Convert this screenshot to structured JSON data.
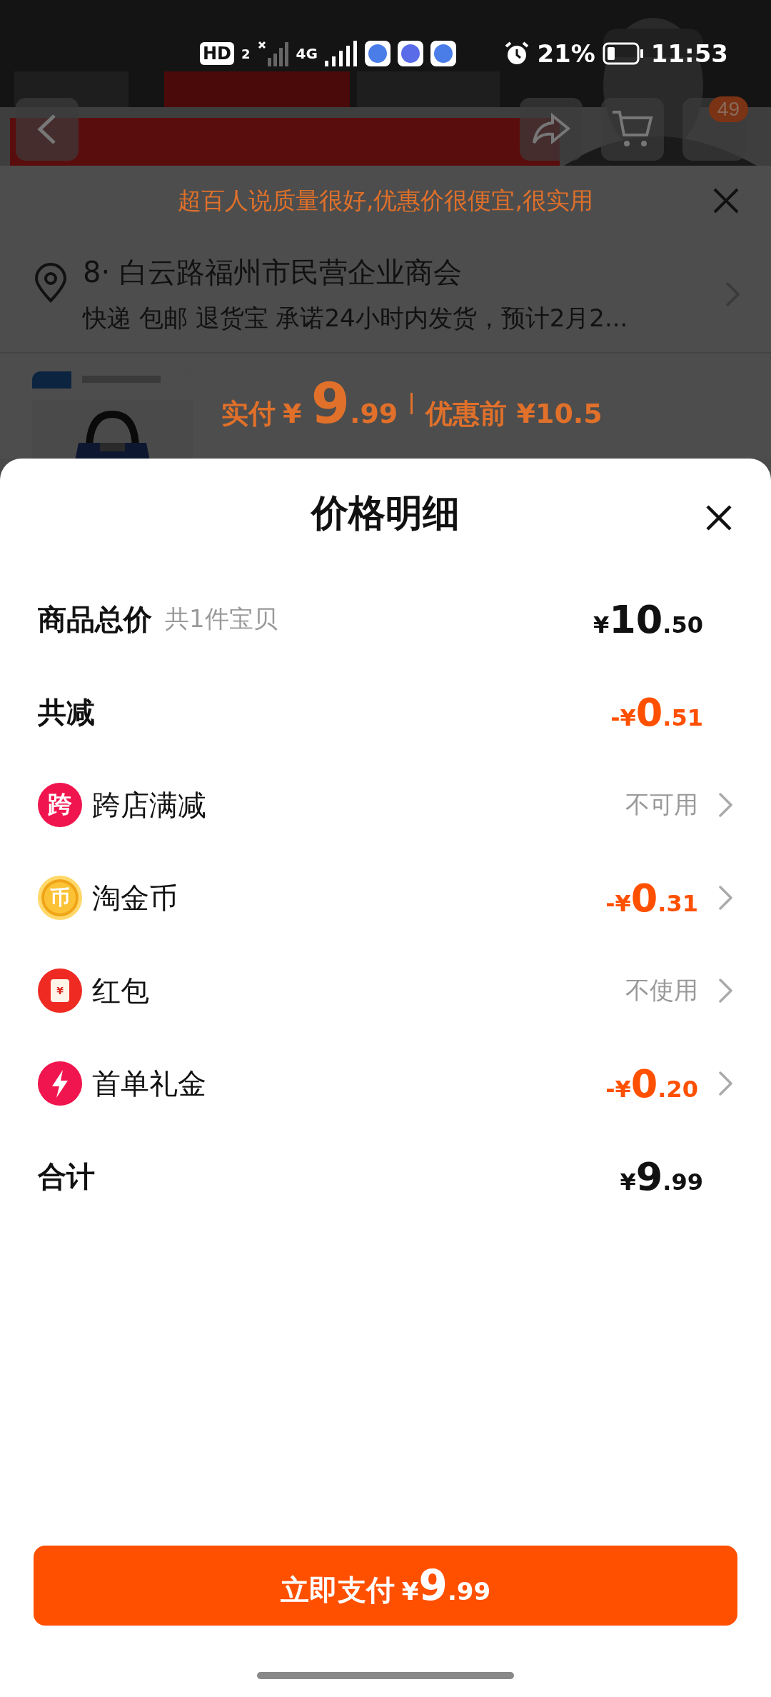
{
  "status_bar": {
    "hd": "HD",
    "sim": "2",
    "network": "4G",
    "battery_percent": "21%",
    "time": "11:53"
  },
  "header": {
    "cart_badge": "49"
  },
  "notice": {
    "text": "超百人说质量很好,优惠价很便宜,很实用"
  },
  "address": {
    "line": "8· 白云路福州市民营企业商会",
    "details": "快递 包邮 退货宝 承诺24小时内发货，预计2月2..."
  },
  "product": {
    "paid_label": "实付",
    "price": {
      "currency": "¥",
      "integer": "9",
      "decimal": ".99"
    },
    "before_label": "优惠前 ¥10.5"
  },
  "sheet": {
    "title": "价格明细",
    "rows": [
      {
        "kind": "summary",
        "label": "商品总价",
        "note": "共1件宝贝",
        "price": {
          "currency": "¥",
          "integer": "10",
          "decimal": ".50",
          "discount": false
        }
      },
      {
        "kind": "summary",
        "label": "共减",
        "price": {
          "sign": "-",
          "currency": "¥",
          "integer": "0",
          "decimal": ".51",
          "discount": true
        }
      },
      {
        "kind": "cross_store",
        "icon_text": "跨",
        "label": "跨店满减",
        "status": "不可用"
      },
      {
        "kind": "coin",
        "icon_text": "币",
        "label": "淘金币",
        "price": {
          "sign": "-",
          "currency": "¥",
          "integer": "0",
          "decimal": ".31",
          "discount": true
        }
      },
      {
        "kind": "envelope",
        "icon_text": "¥",
        "label": "红包",
        "status": "不使用"
      },
      {
        "kind": "bolt",
        "label": "首单礼金",
        "price": {
          "sign": "-",
          "currency": "¥",
          "integer": "0",
          "decimal": ".20",
          "discount": true
        }
      },
      {
        "kind": "summary",
        "label": "合计",
        "price": {
          "currency": "¥",
          "integer": "9",
          "decimal": ".99",
          "discount": false
        }
      }
    ],
    "pay_button": {
      "label": "立即支付",
      "price": {
        "currency": "¥",
        "integer": "9",
        "decimal": ".99"
      }
    }
  }
}
